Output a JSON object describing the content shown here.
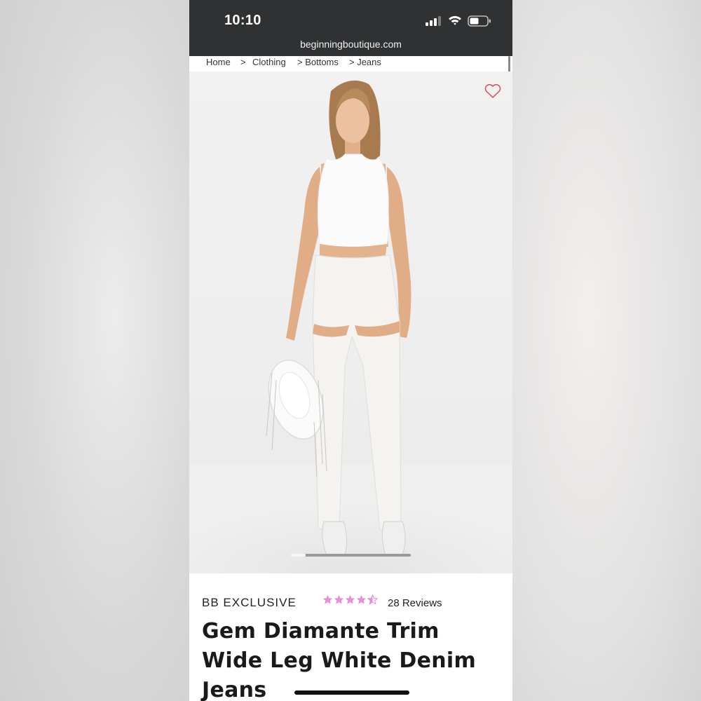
{
  "status_bar": {
    "time": "10:10",
    "icons": [
      "signal-icon",
      "wifi-icon",
      "battery-icon"
    ]
  },
  "browser": {
    "url": "beginningboutique.com"
  },
  "breadcrumb": {
    "home": "Home",
    "sep1": ">",
    "clothing": "Clothing",
    "bottoms": "> Bottoms",
    "jeans": "> Jeans"
  },
  "product": {
    "brand": "BB EXCLUSIVE",
    "rating": 4.5,
    "rating_max": 5,
    "reviews": "28 Reviews",
    "title": "Gem Diamante Trim Wide Leg White Denim Jeans",
    "wishlist_icon": "heart-outline-icon",
    "image_count_active": 1
  },
  "colors": {
    "status_bar": "#2f3133",
    "star": "#e98fd8",
    "heart": "#d45a6a"
  }
}
